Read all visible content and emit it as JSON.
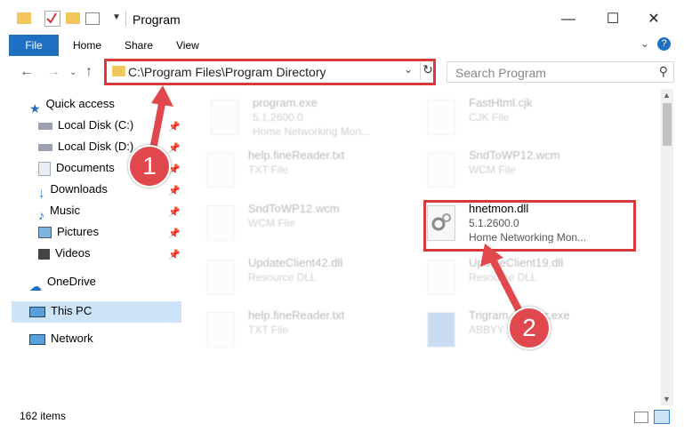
{
  "window": {
    "title": "Program",
    "min_icon": "minimize-icon",
    "max_icon": "maximize-icon",
    "close_icon": "close-icon"
  },
  "ribbon": {
    "file": "File",
    "home": "Home",
    "share": "Share",
    "view": "View"
  },
  "address": {
    "path": "C:\\Program Files\\Program Directory"
  },
  "search": {
    "placeholder": "Search Program"
  },
  "nav": {
    "quick_access": "Quick access",
    "items": [
      {
        "label": "Local Disk (C:)",
        "icon": "drive-icon"
      },
      {
        "label": "Local Disk (D:)",
        "icon": "drive-icon"
      },
      {
        "label": "Documents",
        "icon": "documents-icon"
      },
      {
        "label": "Downloads",
        "icon": "downloads-icon"
      },
      {
        "label": "Music",
        "icon": "music-icon"
      },
      {
        "label": "Pictures",
        "icon": "pictures-icon"
      },
      {
        "label": "Videos",
        "icon": "videos-icon"
      }
    ],
    "onedrive": "OneDrive",
    "thispc": "This PC",
    "network": "Network"
  },
  "files": [
    {
      "name": "program.exe",
      "type": "5.1.2600.0",
      "desc": "Home Networking Mon..."
    },
    {
      "name": "FastHtml.cjk",
      "type": "CJK File",
      "desc": ""
    },
    {
      "name": "help.fineReader.txt",
      "type": "TXT File",
      "desc": ""
    },
    {
      "name": "SndToWP12.wcm",
      "type": "WCM File",
      "desc": ""
    },
    {
      "name": "SndToWP12.wcm",
      "type": "WCM File",
      "desc": ""
    },
    {
      "name": "hnetmon.dll",
      "type": "5.1.2600.0",
      "desc": "Home Networking Mon..."
    },
    {
      "name": "UpdateClient42.dll",
      "type": "Resource DLL",
      "desc": ""
    },
    {
      "name": "UpdateClient19.dll",
      "type": "Resource DLL",
      "desc": ""
    },
    {
      "name": "help.fineReader.txt",
      "type": "TXT File",
      "desc": ""
    },
    {
      "name": "Trigram...staller.exe",
      "type": "ABBYY ...ler tri...",
      "desc": ""
    }
  ],
  "status": {
    "count": "162 items"
  },
  "badges": {
    "one": "1",
    "two": "2"
  },
  "colors": {
    "accent": "#1f6fc2",
    "highlight": "#d9383c",
    "selection": "#cde3f7"
  }
}
